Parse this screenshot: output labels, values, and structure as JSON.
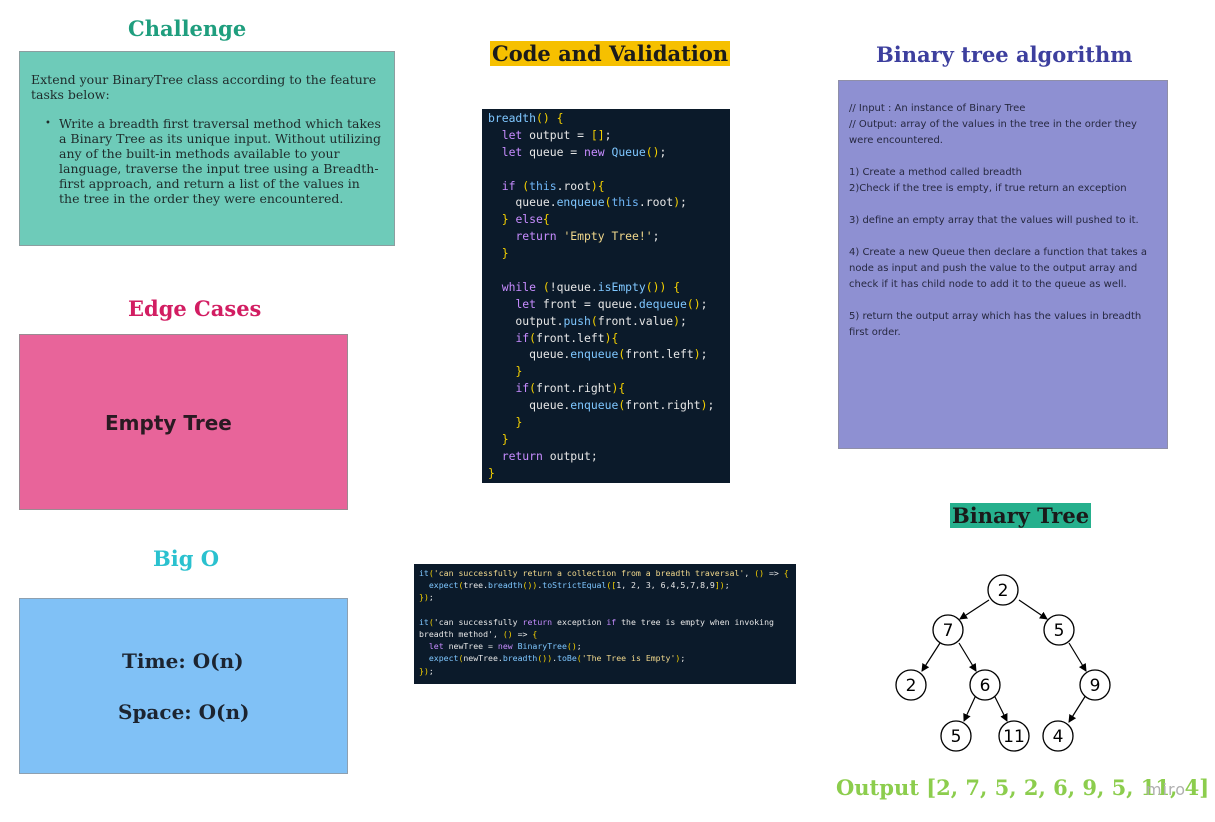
{
  "challenge": {
    "title": "Challenge",
    "intro": "Extend your BinaryTree class according to the feature tasks below:",
    "task": "Write a breadth first traversal method which takes a Binary Tree as its unique input. Without utilizing any of the built-in methods available to your language, traverse the input tree using a Breadth-first approach, and return a list of the values in the tree in the order they were encountered."
  },
  "edge_cases": {
    "title": "Edge Cases",
    "item": "Empty Tree"
  },
  "big_o": {
    "title": "Big O",
    "time": "Time: O(n)",
    "space": "Space: O(n)"
  },
  "code": {
    "title": "Code and Validation",
    "lines": [
      "breadth() {",
      "  let output = [];",
      "  let queue = new Queue();",
      "",
      "  if (this.root){",
      "    queue.enqueue(this.root);",
      "  } else{",
      "    return 'Empty Tree!';",
      "  }",
      "",
      "  while (!queue.isEmpty()) {",
      "    let front = queue.dequeue();",
      "    output.push(front.value);",
      "    if(front.left){",
      "      queue.enqueue(front.left);",
      "    }",
      "    if(front.right){",
      "      queue.enqueue(front.right);",
      "    }",
      "  }",
      "  return output;",
      "}"
    ],
    "test_lines": [
      "it('can successfully return a collection from a breadth traversal', () => {",
      "  expect(tree.breadth()).toStrictEqual([1, 2, 3, 6,4,5,7,8,9]);",
      "});",
      "",
      "it('can successfully return exception if the tree is empty when invoking",
      "breadth method', () => {",
      "  let newTree = new BinaryTree();",
      "  expect(newTree.breadth()).toBe('The Tree is Empty');",
      "});"
    ]
  },
  "algorithm": {
    "title": "Binary tree algorithm",
    "input": "// Input  : An instance of Binary Tree",
    "output": "// Output:  array of the values in the tree in the order they were encountered.",
    "step1": "1) Create a method called breadth",
    "step2": "2)Check if the tree is empty, if true return an exception",
    "step3": "3) define an empty array that the values will pushed to it.",
    "step4": "4) Create a new Queue then declare a function that takes a node  as input and push the value to the output array and check if it has child node to add it to the queue as well.",
    "step5": "5) return the output array which has the values in breadth first order."
  },
  "tree": {
    "title": "Binary Tree",
    "nodes": {
      "root": "2",
      "l": "7",
      "r": "5",
      "ll": "2",
      "lr": "6",
      "rr": "9",
      "lrl": "5",
      "lrr": "11",
      "rrl": "4"
    },
    "output": "Output [2, 7, 5, 2, 6, 9, 5, 11, 4]"
  },
  "watermark": "miro"
}
